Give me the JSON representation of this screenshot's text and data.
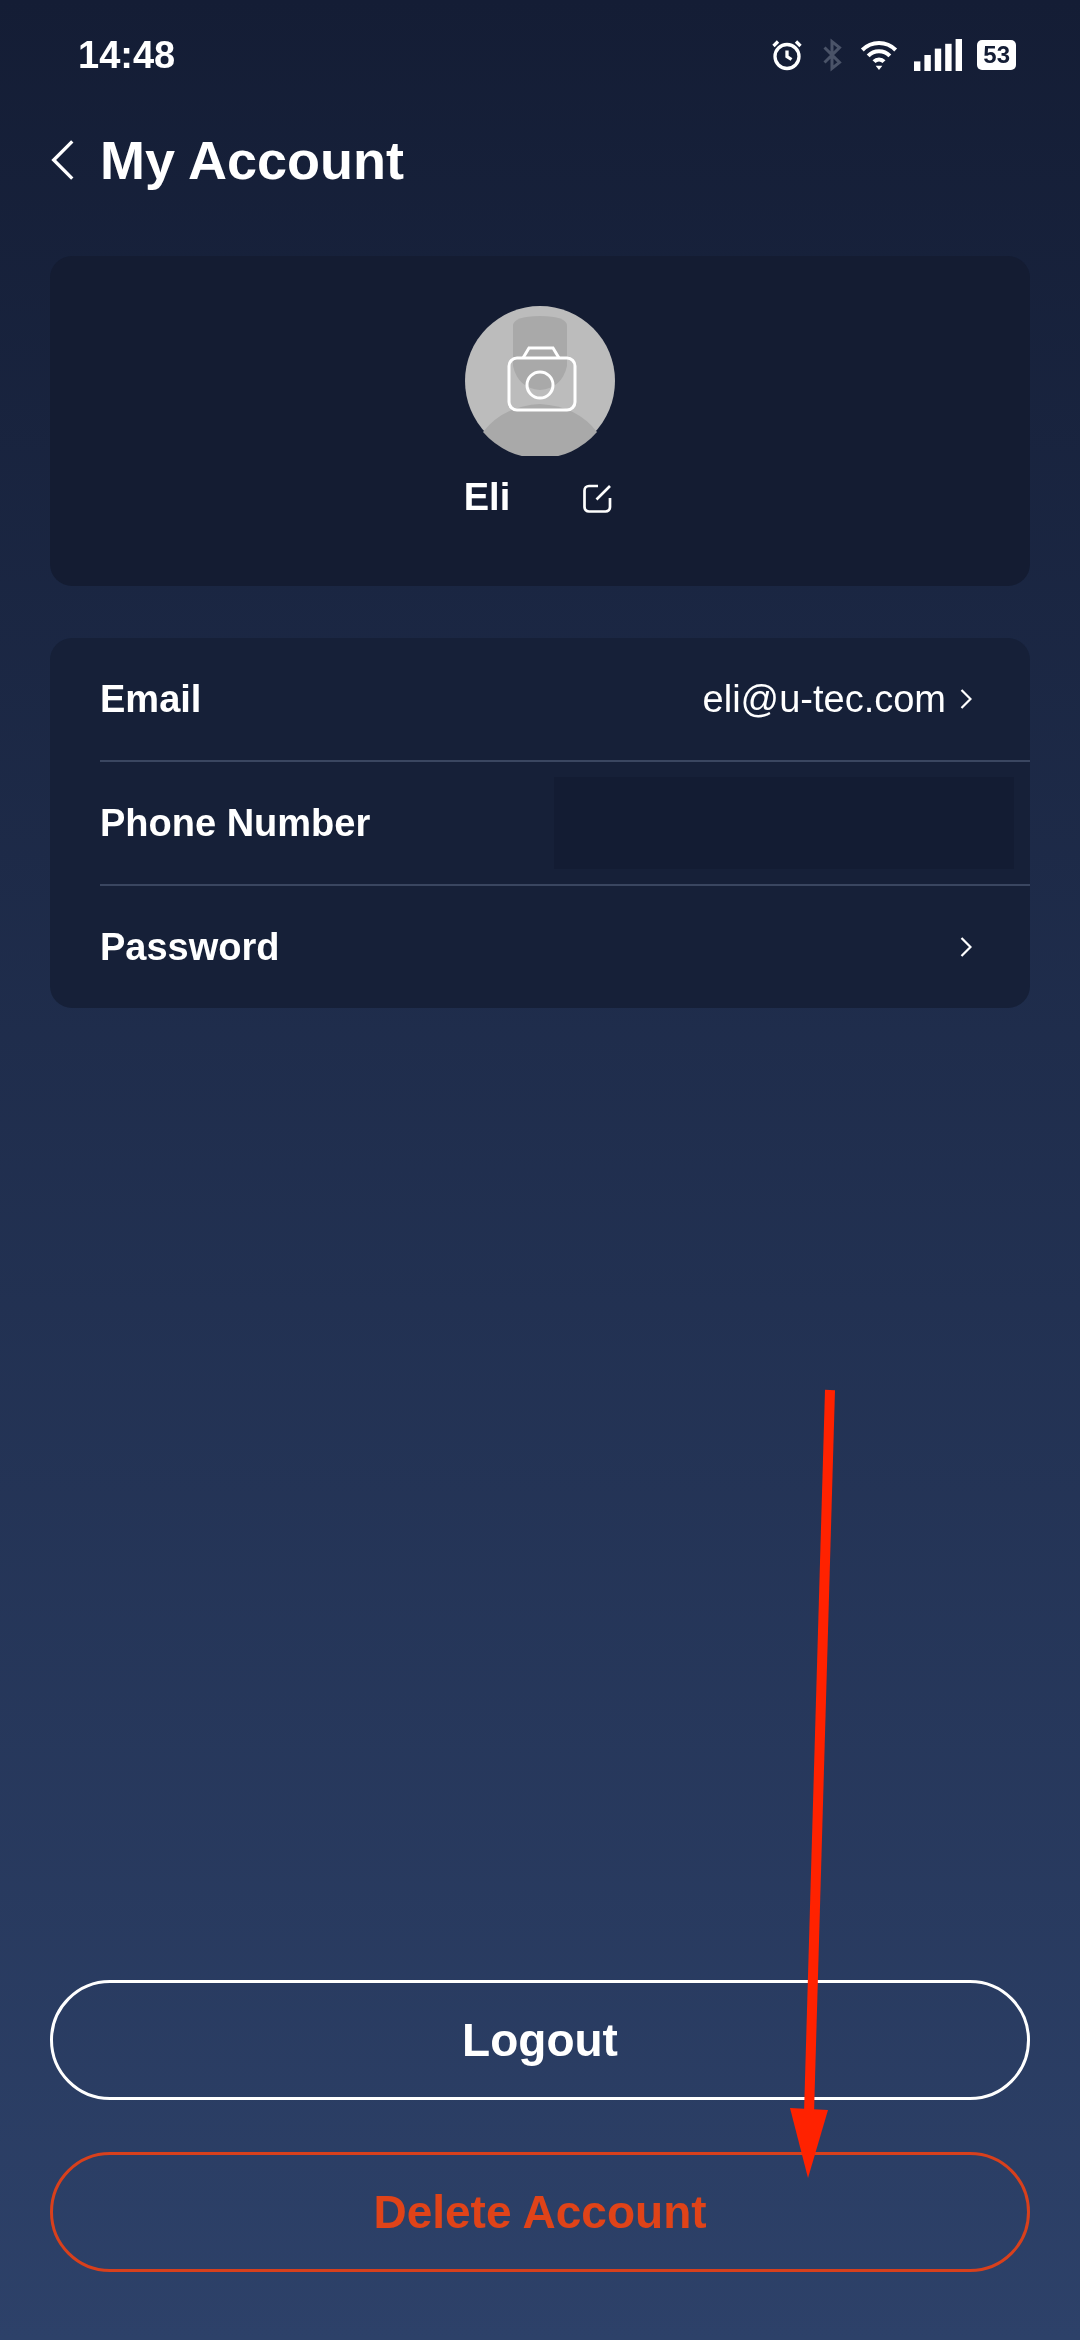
{
  "status_bar": {
    "time": "14:48",
    "battery": "53"
  },
  "header": {
    "title": "My Account"
  },
  "profile": {
    "name": "Eli"
  },
  "settings": [
    {
      "label": "Email",
      "value": "eli@u-tec.com",
      "kind": "link"
    },
    {
      "label": "Phone Number",
      "kind": "redacted"
    },
    {
      "label": "Password",
      "kind": "link"
    }
  ],
  "buttons": [
    {
      "label": "Logout",
      "kind": "normal"
    },
    {
      "label": "Delete Account",
      "kind": "danger"
    }
  ]
}
